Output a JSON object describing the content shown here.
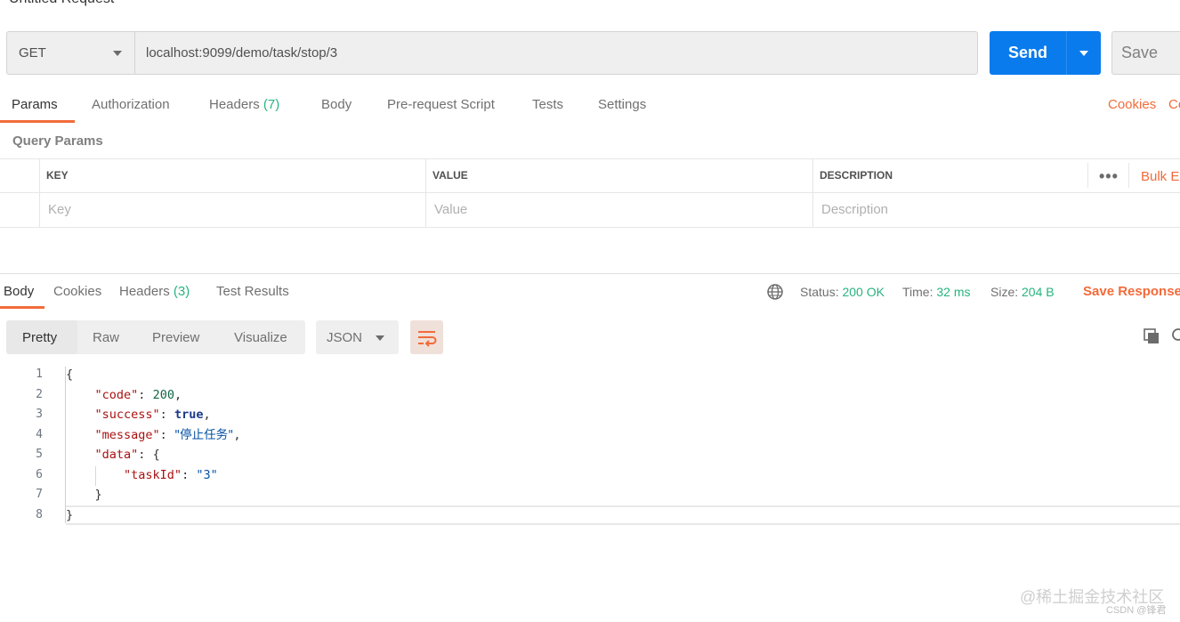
{
  "header": {
    "title": "Untitled Request"
  },
  "request": {
    "method": "GET",
    "url": "localhost:9099/demo/task/stop/3",
    "send_label": "Send",
    "save_label": "Save"
  },
  "request_tabs": {
    "params": "Params",
    "authorization": "Authorization",
    "headers": "Headers",
    "headers_count": "(7)",
    "body": "Body",
    "prerequest": "Pre-request Script",
    "tests": "Tests",
    "settings": "Settings",
    "cookies": "Cookies",
    "code": "Co"
  },
  "query_params": {
    "title": "Query Params",
    "columns": {
      "key": "KEY",
      "value": "VALUE",
      "description": "DESCRIPTION"
    },
    "placeholders": {
      "key": "Key",
      "value": "Value",
      "description": "Description"
    },
    "more": "•••",
    "bulk_edit": "Bulk Ed"
  },
  "response_tabs": {
    "body": "Body",
    "cookies": "Cookies",
    "headers": "Headers",
    "headers_count": "(3)",
    "test_results": "Test Results"
  },
  "response_meta": {
    "status_label": "Status:",
    "status_value": "200 OK",
    "time_label": "Time:",
    "time_value": "32 ms",
    "size_label": "Size:",
    "size_value": "204 B",
    "save_response": "Save Response"
  },
  "view": {
    "pretty": "Pretty",
    "raw": "Raw",
    "preview": "Preview",
    "visualize": "Visualize",
    "format": "JSON"
  },
  "code_lines": {
    "n": [
      "1",
      "2",
      "3",
      "4",
      "5",
      "6",
      "7",
      "8"
    ],
    "l1": "{",
    "l2_key": "\"code\"",
    "l2_val": "200",
    "l3_key": "\"success\"",
    "l3_val": "true",
    "l4_key": "\"message\"",
    "l4_val": "\"停止任务\"",
    "l5_key": "\"data\"",
    "l5_val": "{",
    "l6_key": "\"taskId\"",
    "l6_val": "\"3\"",
    "l7": "}",
    "l8": "}"
  },
  "watermark": {
    "main": "@稀土掘金技术社区",
    "sub": "CSDN @锋君"
  },
  "colors": {
    "accent": "#f26b3a",
    "send": "#097bed",
    "success": "#26b47f"
  }
}
